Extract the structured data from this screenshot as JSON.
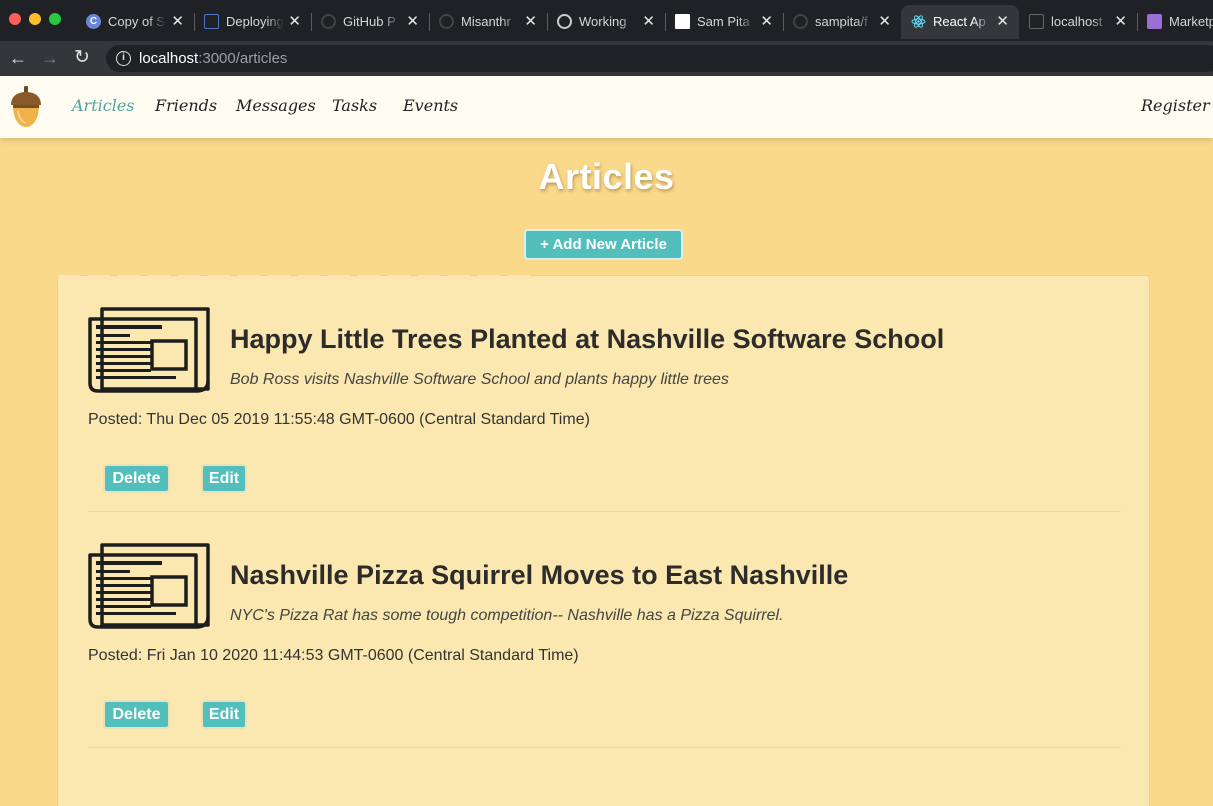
{
  "browser": {
    "tabs": [
      {
        "title": "Copy of S",
        "favicon": "chrome-c-icon",
        "color": "#6b85d8",
        "active": false
      },
      {
        "title": "Deploying",
        "favicon": "doc-icon",
        "color": "#4b78c4",
        "active": false
      },
      {
        "title": "GitHub P",
        "favicon": "github-icon",
        "color": "#444444",
        "active": false
      },
      {
        "title": "Misanthr",
        "favicon": "github-icon",
        "color": "#444444",
        "active": false
      },
      {
        "title": "Working",
        "favicon": "github-icon",
        "color": "#cccccc",
        "active": false
      },
      {
        "title": "Sam Pita",
        "favicon": "blank-page-icon",
        "color": "#ffffff",
        "active": false
      },
      {
        "title": "sampita/f",
        "favicon": "github-icon",
        "color": "#444444",
        "active": false
      },
      {
        "title": "React Ap",
        "favicon": "react-icon",
        "color": "#61dafb",
        "active": true
      },
      {
        "title": "localhost",
        "favicon": "page-icon",
        "color": "#666666",
        "active": false
      },
      {
        "title": "Marketp",
        "favicon": "vs-icon",
        "color": "#9b6fd6",
        "active": false
      }
    ],
    "url_host": "localhost",
    "url_path": ":3000/articles"
  },
  "nav": {
    "links": [
      "Articles",
      "Friends",
      "Messages",
      "Tasks",
      "Events"
    ],
    "register": "Register"
  },
  "page": {
    "title": "Articles",
    "add_button": "+ Add New Article"
  },
  "articles": [
    {
      "title": "Happy Little Trees Planted at Nashville Software School",
      "synopsis": "Bob Ross visits Nashville Software School and plants happy little trees",
      "posted": "Posted: Thu Dec 05 2019 11:55:48 GMT-0600 (Central Standard Time)",
      "delete_label": "Delete",
      "edit_label": "Edit"
    },
    {
      "title": "Nashville Pizza Squirrel Moves to East Nashville",
      "synopsis": "NYC's Pizza Rat has some tough competition-- Nashville has a Pizza Squirrel.",
      "posted": "Posted: Fri Jan 10 2020 11:44:53 GMT-0600 (Central Standard Time)",
      "delete_label": "Delete",
      "edit_label": "Edit"
    }
  ],
  "colors": {
    "page_bg": "#fad98a",
    "card_bg": "#fbe8b1",
    "button": "#53bfbd",
    "nav_active": "#4fa3a1"
  }
}
